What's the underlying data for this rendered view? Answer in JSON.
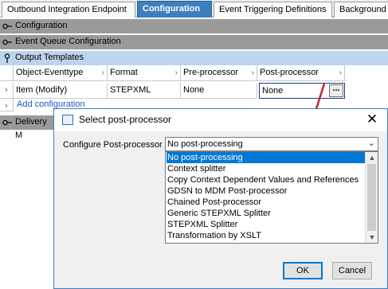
{
  "tabs": [
    {
      "label": "Outbound Integration Endpoint",
      "active": false
    },
    {
      "label": "Configuration",
      "active": true
    },
    {
      "label": "Event Triggering Definitions",
      "active": false
    },
    {
      "label": "Background",
      "active": false
    }
  ],
  "sections": {
    "configuration": "Configuration",
    "event_queue": "Event Queue Configuration",
    "output_templates": "Output Templates",
    "delivery": "Delivery M"
  },
  "grid": {
    "headers": [
      "Object-Eventtype",
      "Format",
      "Pre-processor",
      "Post-processor"
    ],
    "row": {
      "object_eventtype": "Item (Modify)",
      "format": "STEPXML",
      "pre_processor": "None",
      "post_processor": "None"
    },
    "edit_button": "...",
    "add_link": "Add configuration"
  },
  "dialog": {
    "title": "Select post-processor",
    "label": "Configure Post-processor",
    "selected": "No post-processing",
    "options": [
      "No post-processing",
      "Context splitter",
      "Copy Context Dependent Values and References",
      "GDSN to MDM Post-processor",
      "Chained Post-processor",
      "Generic STEPXML Splitter",
      "STEPXML Splitter",
      "Transformation by XSLT"
    ],
    "ok": "OK",
    "cancel": "Cancel",
    "close_glyph": "✕"
  },
  "colors": {
    "active_tab": "#3d7ebf",
    "section_gray": "#9a9a9a",
    "section_blue": "#bcd4ec",
    "selection": "#0078d7",
    "annotation_arrow": "#c0282c"
  },
  "icons": {
    "collapsed_section": "key-collapsed-icon",
    "expanded_section": "pin-expanded-icon"
  }
}
